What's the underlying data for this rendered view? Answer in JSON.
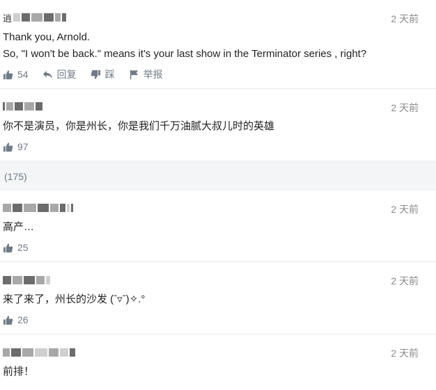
{
  "comments": [
    {
      "user": {
        "initial": "逍"
      },
      "time": "2 天前",
      "lines": [
        "Thank you, Arnold.",
        "So, \"I won't be back.\" means it's your last show in the Terminator series , right?"
      ],
      "likes": "54",
      "reply_label": "回复",
      "dislike_label": "踩",
      "report_label": "举报"
    },
    {
      "time": "2 天前",
      "text": "你不是演员，你是州长，你是我们千万油腻大叔儿时的英雄",
      "likes": "97"
    },
    {
      "time": "2 天前",
      "text": "高产…",
      "likes": "25"
    },
    {
      "time": "2 天前",
      "text": "来了来了，州长的沙发 (ˉ▿ˉ)✧.°",
      "likes": "26"
    },
    {
      "time": "2 天前",
      "text": "前排！"
    }
  ],
  "replies_count": "(175)",
  "icons": {
    "like": "thumbs-up-icon",
    "reply": "reply-arrow-icon",
    "dislike": "thumbs-down-icon",
    "report": "flag-icon"
  },
  "colors": {
    "action": "#6f7b87",
    "time": "#8a8a8a",
    "section_bg": "#f4f5f6"
  }
}
